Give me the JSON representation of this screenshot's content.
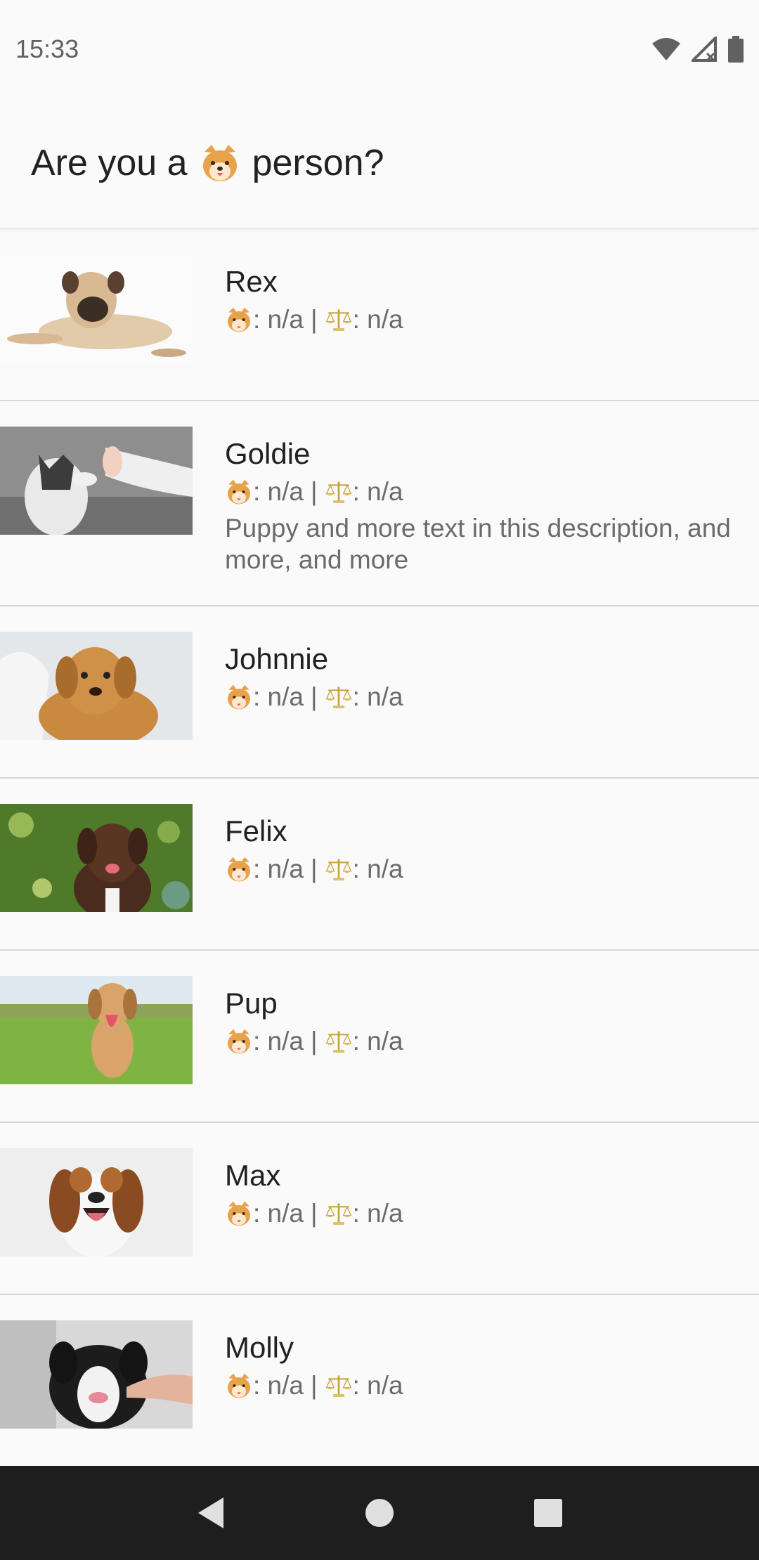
{
  "status_bar": {
    "time": "15:33",
    "icons": [
      "wifi-icon",
      "cell-signal-icon",
      "battery-icon"
    ]
  },
  "app_bar": {
    "title_prefix": "Are you a",
    "title_emoji": "dog-face-icon",
    "title_suffix": "person?"
  },
  "list": {
    "items": [
      {
        "name": "Rex",
        "age_label": ": n/a",
        "separator": "|",
        "weight_label": ": n/a",
        "description": ""
      },
      {
        "name": "Goldie",
        "age_label": ": n/a",
        "separator": "|",
        "weight_label": ": n/a",
        "description": "Puppy and more text in this description, and more, and more"
      },
      {
        "name": "Johnnie",
        "age_label": ": n/a",
        "separator": "|",
        "weight_label": ": n/a",
        "description": ""
      },
      {
        "name": "Felix",
        "age_label": ": n/a",
        "separator": "|",
        "weight_label": ": n/a",
        "description": ""
      },
      {
        "name": "Pup",
        "age_label": ": n/a",
        "separator": "|",
        "weight_label": ": n/a",
        "description": ""
      },
      {
        "name": "Max",
        "age_label": ": n/a",
        "separator": "|",
        "weight_label": ": n/a",
        "description": ""
      },
      {
        "name": "Molly",
        "age_label": ": n/a",
        "separator": "|",
        "weight_label": ": n/a",
        "description": ""
      }
    ]
  },
  "nav_bar": {
    "buttons": [
      "back-icon",
      "home-icon",
      "recents-icon"
    ]
  },
  "colors": {
    "background": "#fafafa",
    "nav_bar": "#1e1e1e",
    "divider": "#d6d6d6",
    "secondary_text": "#6b6b6b",
    "doge_orange": "#e8a24a"
  }
}
